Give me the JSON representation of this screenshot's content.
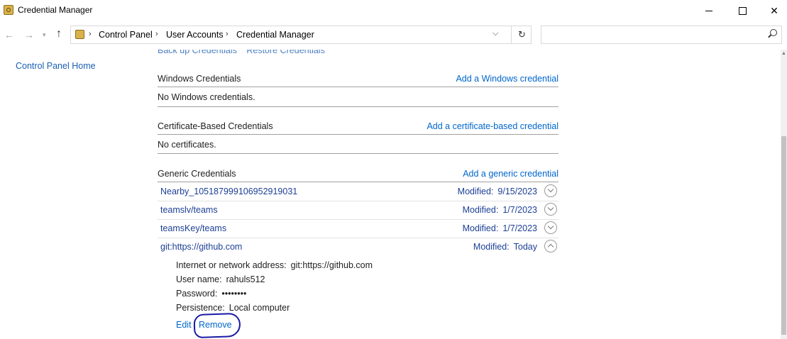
{
  "window": {
    "title": "Credential Manager",
    "icon": "credential-manager-icon",
    "controls": [
      "minimize-icon",
      "maximize-icon",
      "close-icon"
    ]
  },
  "nav": {
    "breadcrumbs": [
      "Control Panel",
      "User Accounts",
      "Credential Manager"
    ],
    "search_placeholder": ""
  },
  "sidebar": {
    "home_link": "Control Panel Home"
  },
  "top_links": {
    "backup": "Back up Credentials",
    "restore": "Restore Credentials"
  },
  "windows_credentials": {
    "title": "Windows Credentials",
    "add_link": "Add a Windows credential",
    "empty": "No Windows credentials."
  },
  "certificate_credentials": {
    "title": "Certificate-Based Credentials",
    "add_link": "Add a certificate-based credential",
    "empty": "No certificates."
  },
  "generic_credentials": {
    "title": "Generic Credentials",
    "add_link": "Add a generic credential",
    "modified_label": "Modified:",
    "items": [
      {
        "name": "Nearby_105187999106952919031",
        "date": "9/15/2023",
        "expanded": false
      },
      {
        "name": "teamslv/teams",
        "date": "1/7/2023",
        "expanded": false
      },
      {
        "name": "teamsKey/teams",
        "date": "1/7/2023",
        "expanded": false
      },
      {
        "name": "git:https://github.com",
        "date": "Today",
        "expanded": true
      }
    ],
    "details": {
      "address_label": "Internet or network address:",
      "address_value": "git:https://github.com",
      "username_label": "User name:",
      "username_value": "rahuls512",
      "password_label": "Password:",
      "password_value": "••••••••",
      "persistence_label": "Persistence:",
      "persistence_value": "Local computer",
      "edit": "Edit",
      "remove": "Remove"
    }
  },
  "colors": {
    "link": "#0066cc",
    "credential_text": "#1c3f95",
    "annotation": "#1a1aa6"
  }
}
